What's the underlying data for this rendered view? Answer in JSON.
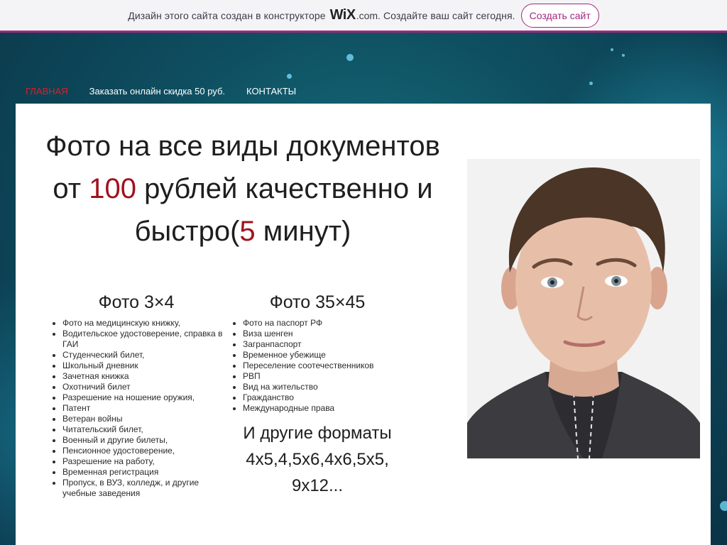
{
  "banner": {
    "text_before": "Дизайн этого сайта создан в конструкторе",
    "logo": "WiX",
    "logo_suffix": ".com.",
    "text_after": "Создайте ваш сайт сегодня.",
    "cta_label": "Создать сайт",
    "accent_color": "#a0287f"
  },
  "nav": {
    "items": [
      "ГЛАВНАЯ",
      "Заказать онлайн скидка 50 руб.",
      "КОНТАКТЫ"
    ],
    "active_index": 0
  },
  "headline": {
    "line1": "Фото на все виды документов",
    "line2_before": "от ",
    "line2_price": "100",
    "line2_after": " рублей качественно и",
    "line3_before": "быстро(",
    "line3_minutes": "5",
    "line3_after": " минут)",
    "accent_color": "#a1121c"
  },
  "format_3x4": {
    "title": "Фото 3×4",
    "items": [
      "Фото на медицинскую книжку,",
      "Водительское удостоверение, справка в ГАИ",
      "Студенческий билет,",
      "Школьный дневник",
      "Зачетная книжка",
      "Охотничий билет",
      "Разрешение на ношение оружия,",
      "Патент",
      "Ветеран войны",
      "Читательский билет,",
      "Военный и другие билеты,",
      "Пенсионное удостоверение,",
      "Разрешение на работу,",
      "Временная регистрация",
      "Пропуск, в ВУЗ, колледж, и другие учебные заведения"
    ]
  },
  "format_35x45": {
    "title": "Фото 35×45",
    "items": [
      "Фото на паспорт РФ",
      "Виза шенген",
      "Загранпаспорт",
      "Временное убежище",
      "Переселение соотечественников",
      "РВП",
      "Вид на жительство",
      "Гражданство",
      "Международные права"
    ]
  },
  "other_formats": {
    "line1": "И другие форматы",
    "line2": "4х5,4,5х6,4х6,5х5,",
    "line3": "9х12..."
  },
  "photo": {
    "icon": "portrait-photo"
  }
}
